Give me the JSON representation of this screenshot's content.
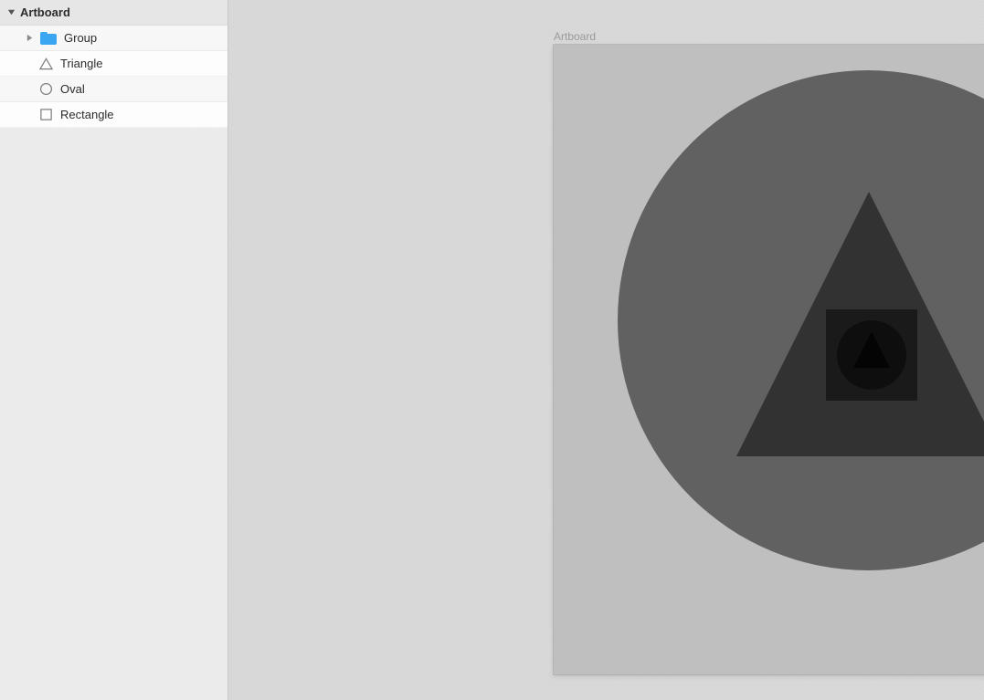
{
  "layers": {
    "artboard": "Artboard",
    "rows": [
      {
        "name": "Group",
        "kind": "group"
      },
      {
        "name": "Triangle",
        "kind": "triangle"
      },
      {
        "name": "Oval",
        "kind": "oval"
      },
      {
        "name": "Rectangle",
        "kind": "rectangle"
      }
    ]
  },
  "canvas": {
    "artboard_label": "Artboard",
    "shapes": {
      "oval": "Oval",
      "triangle": "Triangle",
      "group": {
        "rect": "Rectangle",
        "oval": "Oval",
        "triangle": "Triangle"
      }
    }
  },
  "colors": {
    "panel_bg": "#ececec",
    "canvas_bg": "#d9d9d9",
    "artboard_bg": "#bfbfbf",
    "shape_fill": "rgba(99,99,99,0.80)",
    "folder": "#3aa6f2"
  }
}
